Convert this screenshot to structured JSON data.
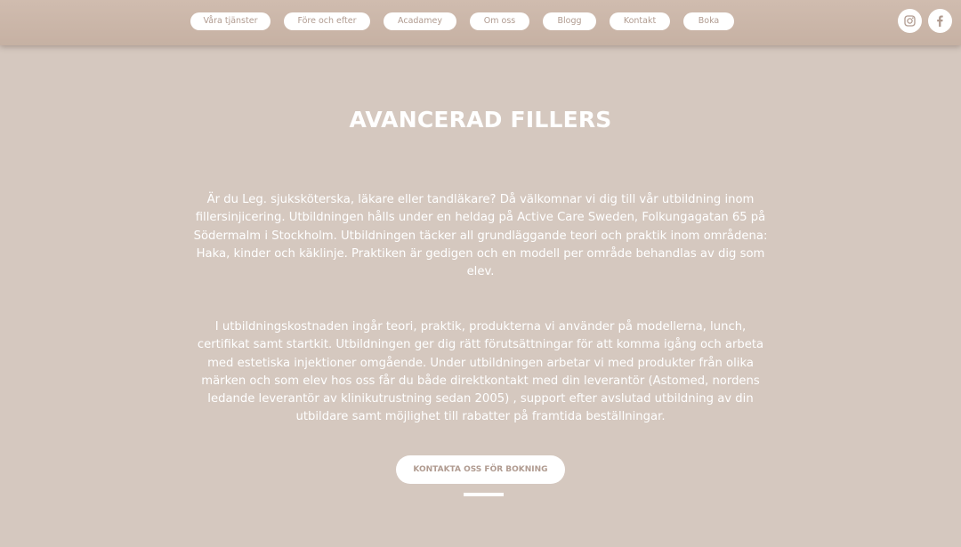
{
  "nav": {
    "items": [
      {
        "label": "Våra tjänster"
      },
      {
        "label": "Före och efter"
      },
      {
        "label": "Acadamey"
      },
      {
        "label": "Om oss"
      },
      {
        "label": "Blogg"
      },
      {
        "label": "Kontakt"
      },
      {
        "label": "Boka"
      }
    ]
  },
  "social": {
    "instagram_icon": "instagram-icon",
    "facebook_icon": "facebook-icon"
  },
  "colors": {
    "background": "#d5c8bf",
    "header": "#c9b5a8",
    "accent_text": "#b09b90",
    "text": "#ffffff"
  },
  "main": {
    "title": "AVANCERAD FILLERS",
    "paragraph1": "Är du Leg. sjuksköterska, läkare eller tandläkare? Då välkomnar vi dig till vår utbildning inom fillersinjicering. Utbildningen hålls under en heldag på Active Care Sweden, Folkungagatan 65 på Södermalm i Stockholm. Utbildningen täcker all grundläggande teori och praktik inom områdena: Haka, kinder och käklinje. Praktiken är gedigen och en modell per område behandlas av dig som elev.",
    "paragraph2": "I utbildningskostnaden ingår teori, praktik, produkterna vi använder på modellerna, lunch, certifikat samt startkit. Utbildningen ger dig rätt förutsättningar för att komma igång och arbeta med estetiska injektioner omgående. Under utbildningen arbetar vi med produkter från olika märken och som elev hos oss får du både direktkontakt med din leverantör (Astomed, nordens ledande leverantör av klinikutrustning sedan 2005) , support efter avslutad utbildning av din utbildare samt möjlighet till rabatter på framtida beställningar.",
    "cta_label": "KONTAKTA OSS FÖR BOKNING"
  }
}
